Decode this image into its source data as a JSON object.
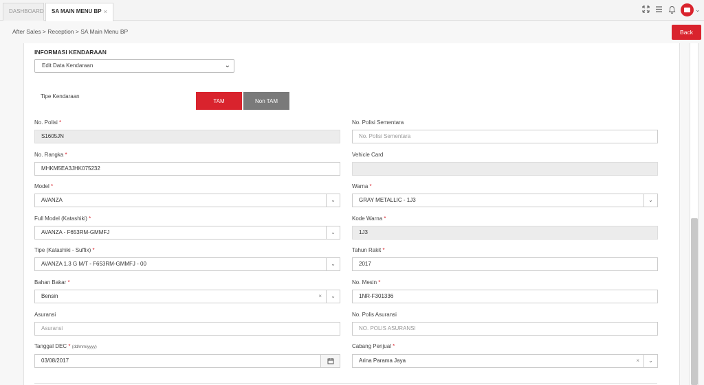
{
  "tabs": [
    {
      "label": "DASHBOARD"
    },
    {
      "label": "SA MAIN MENU BP",
      "close": "×"
    }
  ],
  "breadcrumb": "After Sales > Reception > SA Main Menu BP",
  "back_label": "Back",
  "section_title": "INFORMASI KENDARAAN",
  "edit_select": "Edit Data Kendaraan",
  "tipe_label": "Tipe Kendaraan",
  "tam_label": "TAM",
  "nontam_label": "Non TAM",
  "accent": "#d9232d",
  "icons": [
    "fullscreen-icon",
    "menu-icon",
    "bell-icon",
    "avatar-icon",
    "chevron-down-icon",
    "calendar-icon",
    "clear-icon"
  ],
  "fields": {
    "no_polisi": {
      "label": "No. Polisi",
      "value": "S1605JN"
    },
    "no_polisi_sementara": {
      "label": "No. Polisi Sementara",
      "placeholder": "No. Polisi Sementara"
    },
    "no_rangka": {
      "label": "No. Rangka",
      "value": "MHKM5EA3JHK075232"
    },
    "vehicle_card": {
      "label": "Vehicle Card",
      "value": ""
    },
    "model": {
      "label": "Model",
      "value": "AVANZA"
    },
    "warna": {
      "label": "Warna",
      "value": "GRAY METALLIC - 1J3"
    },
    "full_model": {
      "label": "Full Model (Katashiki)",
      "value": "AVANZA - F653RM-GMMFJ"
    },
    "kode_warna": {
      "label": "Kode Warna",
      "value": "1J3"
    },
    "tipe": {
      "label": "Tipe (Katashiki - Suffix)",
      "value": "AVANZA 1.3 G M/T - F653RM-GMMFJ - 00"
    },
    "tahun_rakit": {
      "label": "Tahun Rakit",
      "value": "2017"
    },
    "bahan_bakar": {
      "label": "Bahan Bakar",
      "value": "Bensin"
    },
    "no_mesin": {
      "label": "No. Mesin",
      "value": "1NR-F301336"
    },
    "asuransi": {
      "label": "Asuransi",
      "placeholder": "Asuransi"
    },
    "no_polis": {
      "label": "No. Polis Asuransi",
      "placeholder": "NO. POLIS ASURANSI"
    },
    "tanggal_dec": {
      "label": "Tanggal DEC",
      "hint": "(dd/mm/yyyy)",
      "value": "03/08/2017"
    },
    "cabang": {
      "label": "Cabang Penjual",
      "value": "Arina Parama Jaya"
    }
  }
}
